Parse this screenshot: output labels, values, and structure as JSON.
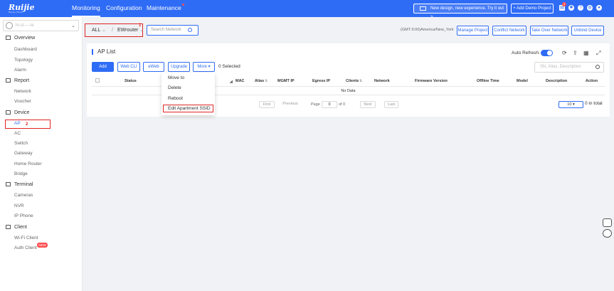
{
  "topbar": {
    "brand": "Ruijie",
    "brand_tagline": "Reyee Cloud",
    "nav": [
      {
        "label": "Monitoring"
      },
      {
        "label": "Configuration"
      },
      {
        "label": "Maintenance"
      }
    ],
    "promo_label": "New design, new experience. Try it out  >",
    "demo_label": "+ Add Demo Project",
    "notification_count": "3"
  },
  "sidebar": {
    "user_name": "hi-sl-----le",
    "groups": [
      {
        "label": "Overview",
        "items": [
          "Dashboard",
          "Topology",
          "Alarm"
        ]
      },
      {
        "label": "Report",
        "items": [
          "Network",
          "Voucher"
        ]
      },
      {
        "label": "Device",
        "items": [
          "AP",
          "AC",
          "Switch",
          "Gateway",
          "Home Router",
          "Bridge"
        ]
      },
      {
        "label": "Terminal",
        "items": [
          "Cameras",
          "NVR",
          "IP Phone"
        ]
      },
      {
        "label": "Client",
        "items": [
          "Wi-Fi Client",
          "Auth Client"
        ]
      }
    ],
    "new_badge": "NEW",
    "annotation_ap": "2"
  },
  "toolbar": {
    "scope": "ALL",
    "separator": "/",
    "network": "EWrouter",
    "annotation_selector": "1",
    "search_placeholder": "Search Network",
    "timezone": "(GMT-5:00)America/New_York",
    "buttons": [
      "Manage Project",
      "Conflict Network",
      "Take Over Network",
      "Unbind Device"
    ]
  },
  "ap_list": {
    "title": "AP List",
    "auto_refresh_label": "Auto Refresh:",
    "auto_refresh_on": true,
    "actions": [
      "Add",
      "Web CLI",
      "eWeb",
      "Upgrade",
      "More"
    ],
    "selected_text": "0 Selected",
    "search_placeholder": "SN, Alias, Description",
    "columns": [
      "Status",
      "MAC",
      "Alias",
      "MGMT IP",
      "Egress IP",
      "Clients",
      "Network",
      "Firmware Version",
      "Offline Time",
      "Model",
      "Description",
      "Action"
    ],
    "empty_text": "No Data",
    "pagination": {
      "first": "First",
      "previous": "Previous",
      "page_label": "Page",
      "page_value": "0",
      "of_label": "of 0",
      "next": "Next",
      "last": "Last",
      "page_size": "10",
      "total_text": "0 in total"
    }
  },
  "more_menu": {
    "items": [
      "Move to",
      "Delete",
      "Reboot",
      "Edit Apartment SSID"
    ]
  },
  "colors": {
    "accent": "#2f6cf6",
    "annotation": "#e02424"
  }
}
